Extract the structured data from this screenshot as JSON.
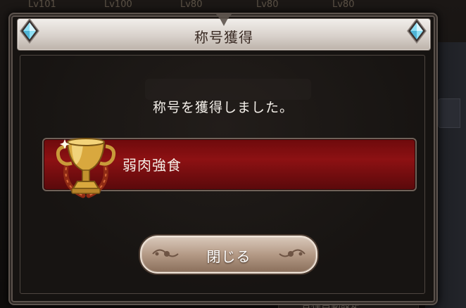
{
  "background": {
    "levels": [
      "Lv101",
      "Lv100",
      "Lv80",
      "Lv80",
      "Lv80"
    ],
    "bottom_button": "各種自動設定"
  },
  "dialog": {
    "title": "称号獲得",
    "message": "称号を獲得しました。",
    "reward": {
      "title_name": "弱肉強食",
      "icon": "trophy-icon"
    },
    "close_label": "閉じる"
  },
  "colors": {
    "title_bar": "#e6e0da",
    "reward_band": "#8d1113",
    "button": "#b49a86",
    "gem": "#7fd3ec"
  }
}
